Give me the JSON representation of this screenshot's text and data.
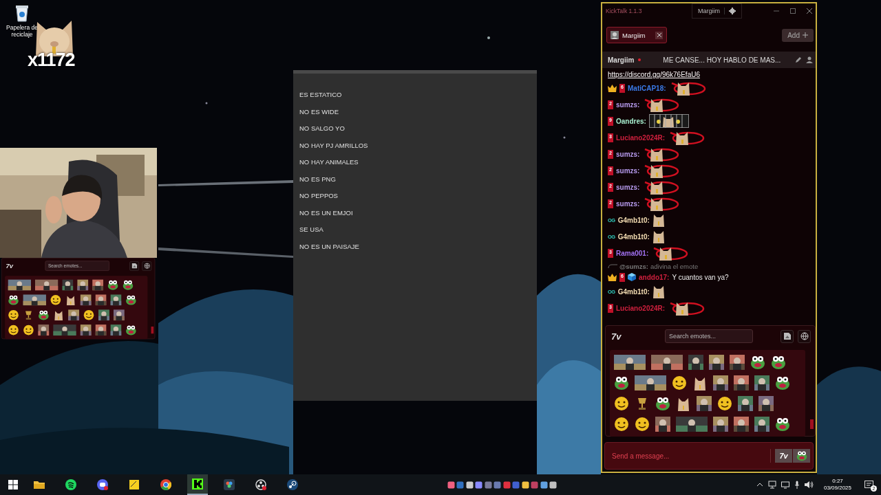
{
  "desktop": {
    "icons": [
      {
        "label": "Papelera de reciclaje"
      }
    ],
    "counter": "x1172"
  },
  "mini_picker": {
    "logo": "7v",
    "search": {
      "placeholder": "Search emotes..."
    }
  },
  "rules_panel": {
    "items": [
      "ES ESTATICO",
      "NO ES WIDE",
      "NO SALGO YO",
      "NO HAY PJ AMRILLOS",
      "NO HAY ANIMALES",
      "NO ES PNG",
      "NO PEPPOS",
      "NO ES UN EMJOI",
      "SE USA",
      "NO ES UN PAISAJE"
    ]
  },
  "chat": {
    "window": {
      "title": "KickTalk 1.1.3",
      "user": "Margiim"
    },
    "tabs": [
      {
        "label": "Margiim",
        "selected": true
      }
    ],
    "add_button": "Add",
    "channel": {
      "name": "Margiim",
      "live": true,
      "stream_title": "ME CANSE... HOY HABLO DE MAS..."
    },
    "link": "https://discord.gg/96k76EfaU6",
    "messages": [
      {
        "badges": [
          {
            "kind": "crown"
          },
          {
            "kind": "sub",
            "text": "6"
          }
        ],
        "user": "MatiCAP18:",
        "color": "#3b7bea",
        "emotes": [
          {
            "kind": "ring"
          }
        ]
      },
      {
        "badges": [
          {
            "kind": "sub",
            "text": "2"
          }
        ],
        "user": "sumzs:",
        "color": "#b89cf0",
        "emotes": [
          {
            "kind": "ring"
          }
        ]
      },
      {
        "badges": [
          {
            "kind": "sub",
            "text": "9"
          }
        ],
        "user": "Oandres:",
        "color": "#a8f0d0",
        "emotes": [
          {
            "kind": "cage"
          }
        ]
      },
      {
        "badges": [
          {
            "kind": "sub",
            "text": "3"
          }
        ],
        "user": "Luciano2024R:",
        "color": "#d0203e",
        "emotes": [
          {
            "kind": "ring"
          }
        ]
      },
      {
        "badges": [
          {
            "kind": "sub",
            "text": "2"
          }
        ],
        "user": "sumzs:",
        "color": "#b89cf0",
        "emotes": [
          {
            "kind": "ring"
          }
        ]
      },
      {
        "badges": [
          {
            "kind": "sub",
            "text": "2"
          }
        ],
        "user": "sumzs:",
        "color": "#b89cf0",
        "emotes": [
          {
            "kind": "ring"
          }
        ]
      },
      {
        "badges": [
          {
            "kind": "sub",
            "text": "2"
          }
        ],
        "user": "sumzs:",
        "color": "#b89cf0",
        "emotes": [
          {
            "kind": "ring"
          }
        ]
      },
      {
        "badges": [
          {
            "kind": "sub",
            "text": "2"
          }
        ],
        "user": "sumzs:",
        "color": "#b89cf0",
        "emotes": [
          {
            "kind": "ring"
          }
        ]
      },
      {
        "badges": [
          {
            "kind": "og",
            "text": "OG"
          }
        ],
        "user": "G4mb1t0:",
        "color": "#f5deb3",
        "emotes": [
          {
            "kind": "cat"
          }
        ]
      },
      {
        "badges": [
          {
            "kind": "og",
            "text": "OG"
          }
        ],
        "user": "G4mb1t0:",
        "color": "#f5deb3",
        "emotes": [
          {
            "kind": "cat"
          }
        ]
      },
      {
        "badges": [
          {
            "kind": "sub",
            "text": "3"
          }
        ],
        "user": "Rama001:",
        "color": "#a070f0",
        "emotes": [
          {
            "kind": "ring"
          }
        ]
      },
      {
        "reply_user": "@sumzs:",
        "reply_text": "adivina el emote",
        "badges": [
          {
            "kind": "crown"
          },
          {
            "kind": "sub",
            "text": "6"
          },
          {
            "kind": "cube"
          }
        ],
        "user": "anddo17:",
        "color": "#d0203e",
        "text": "Y cuantos van ya?"
      },
      {
        "badges": [
          {
            "kind": "og",
            "text": "OG"
          }
        ],
        "user": "G4mb1t0:",
        "color": "#f5deb3",
        "emotes": [
          {
            "kind": "cat"
          }
        ]
      },
      {
        "badges": [
          {
            "kind": "sub",
            "text": "3"
          }
        ],
        "user": "Luciano2024R:",
        "color": "#d0203e",
        "emotes": [
          {
            "kind": "ring"
          }
        ]
      }
    ],
    "emote_picker": {
      "logo": "7v",
      "search": {
        "placeholder": "Search emotes..."
      }
    },
    "input": {
      "placeholder": "Send a message...",
      "logo_button": "7v"
    }
  },
  "taskbar": {
    "apps": [
      {
        "kind": "files",
        "selected": false
      },
      {
        "kind": "spotify",
        "selected": false
      },
      {
        "kind": "discord",
        "selected": false
      },
      {
        "kind": "notes",
        "selected": false
      },
      {
        "kind": "chrome",
        "selected": false
      },
      {
        "kind": "kick",
        "selected": true
      },
      {
        "kind": "davinci",
        "selected": false
      },
      {
        "kind": "obs",
        "selected": false
      },
      {
        "kind": "steam",
        "selected": false
      }
    ],
    "time": "0:27",
    "date": "03/09/2025",
    "notifications": "2"
  }
}
